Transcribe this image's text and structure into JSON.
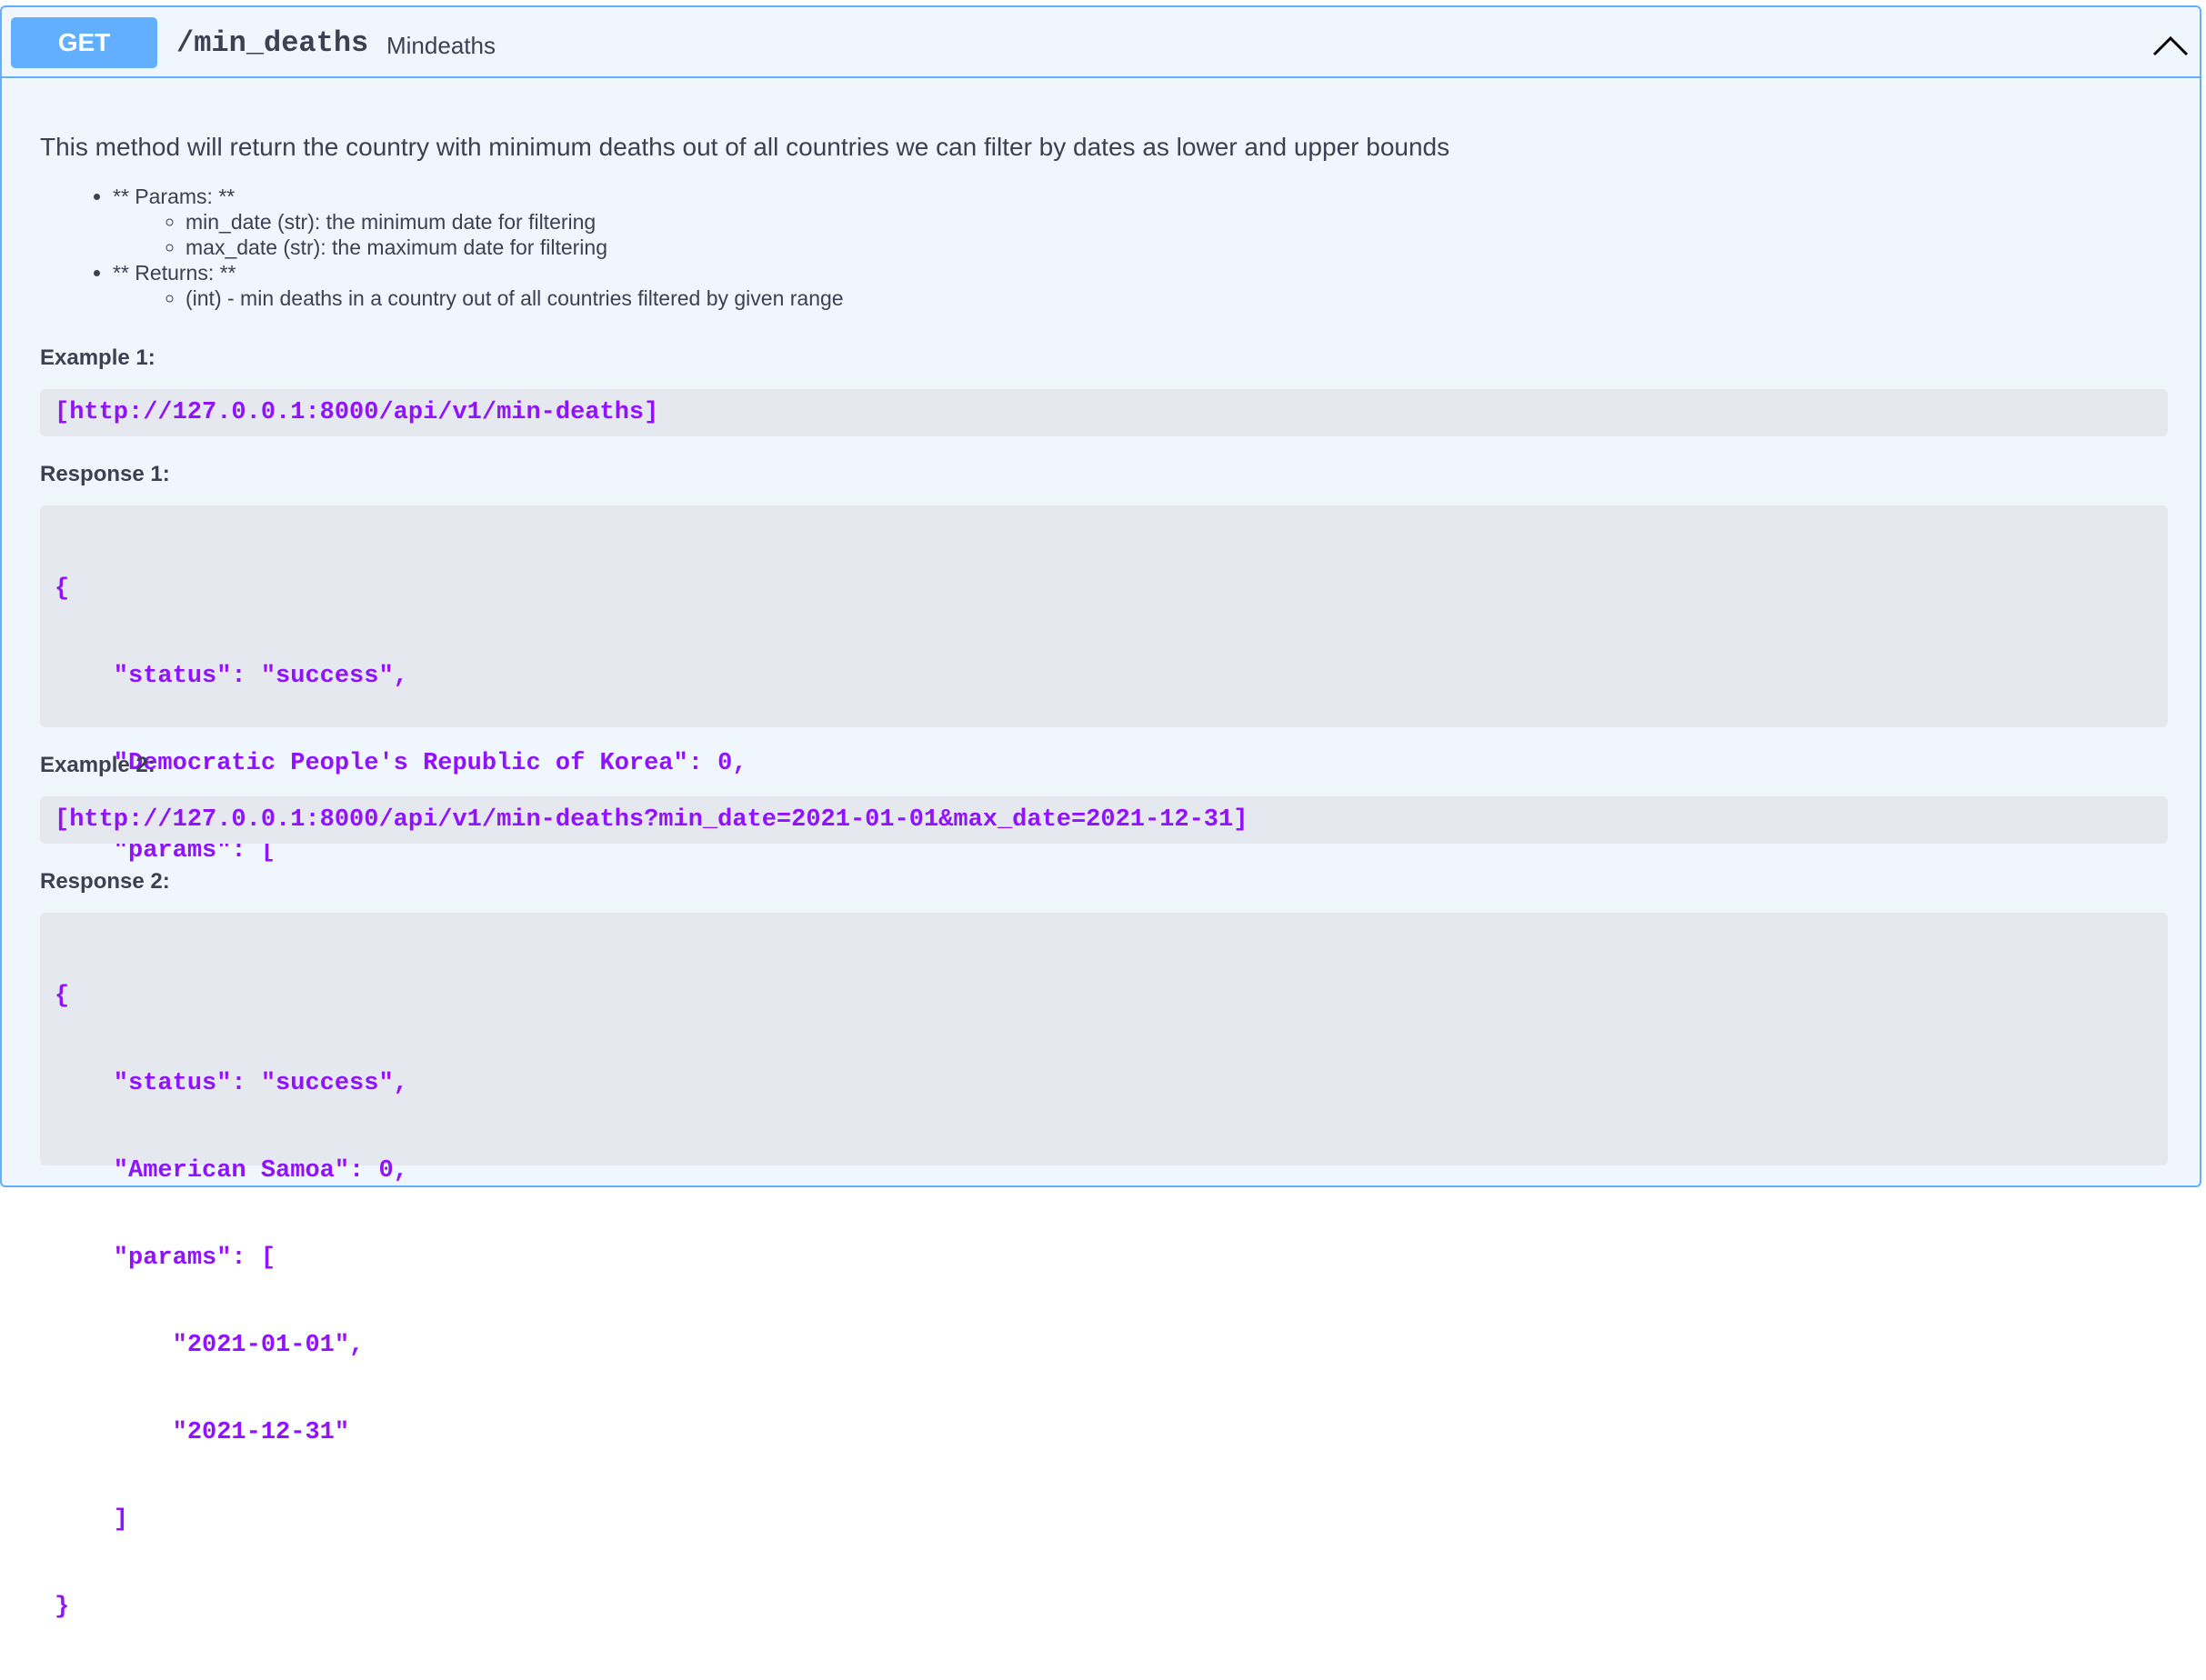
{
  "operation": {
    "method": "GET",
    "path": "/min_deaths",
    "summary": "Mindeaths"
  },
  "description": {
    "intro": "This method will return the country with minimum deaths out of all countries we can filter by dates as lower and upper bounds",
    "sections": [
      {
        "label": "** Params: **",
        "items": [
          "min_date (str): the minimum date for filtering",
          "max_date (str): the maximum date for filtering"
        ]
      },
      {
        "label": "** Returns: **",
        "items": [
          "(int) - min deaths in a country out of all countries filtered by given range"
        ]
      }
    ]
  },
  "examples": [
    {
      "label": "Example 1:",
      "url": "[http://127.0.0.1:8000/api/v1/min-deaths]",
      "response_label": "Response 1:",
      "response_lines": [
        "{",
        "    \"status\": \"success\",",
        "    \"Democratic People's Republic of Korea\": 0,",
        "    \"params\": [",
        "        null",
        "    ]",
        "}"
      ]
    },
    {
      "label": "Example 2:",
      "url": "[http://127.0.0.1:8000/api/v1/min-deaths?min_date=2021-01-01&max_date=2021-12-31]",
      "response_label": "Response 2:",
      "response_lines": [
        "{",
        "    \"status\": \"success\",",
        "    \"American Samoa\": 0,",
        "    \"params\": [",
        "        \"2021-01-01\",",
        "        \"2021-12-31\"",
        "    ]",
        "}"
      ]
    }
  ],
  "icons": {
    "collapse": "chevron-up-icon"
  },
  "colors": {
    "get_accent": "#61affe",
    "panel_bg": "#eff6fd",
    "code_bg": "#e6e8ef",
    "code_text": "#9012fe"
  }
}
